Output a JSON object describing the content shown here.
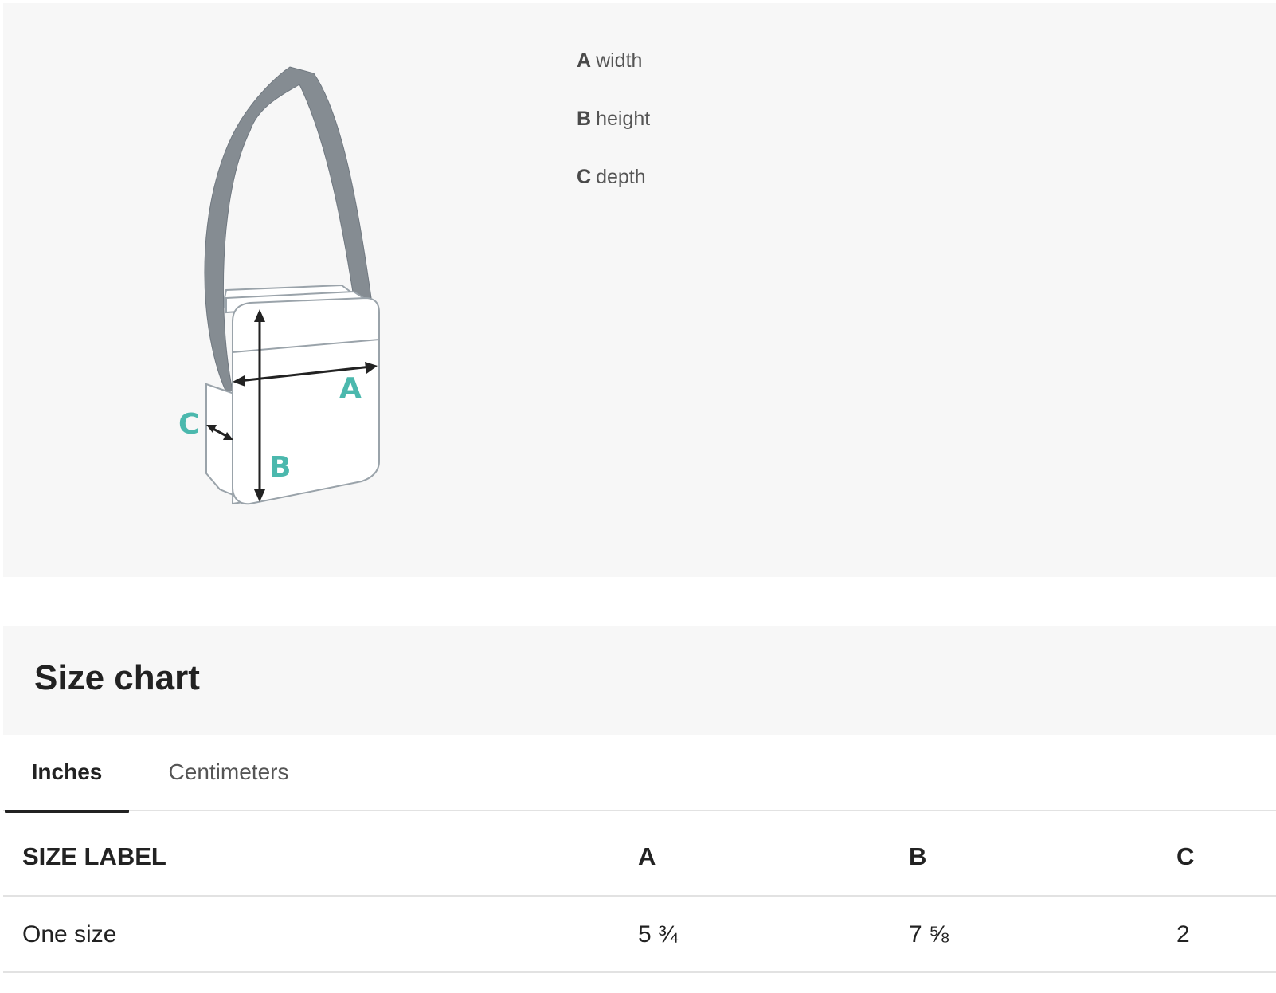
{
  "legend": [
    {
      "letter": "A",
      "text": "width"
    },
    {
      "letter": "B",
      "text": "height"
    },
    {
      "letter": "C",
      "text": "depth"
    }
  ],
  "diagram": {
    "label_a": "A",
    "label_b": "B",
    "label_c": "C"
  },
  "size_chart": {
    "title": "Size chart",
    "tabs": [
      {
        "label": "Inches",
        "active": true
      },
      {
        "label": "Centimeters",
        "active": false
      }
    ],
    "columns": [
      "SIZE LABEL",
      "A",
      "B",
      "C"
    ],
    "rows": [
      [
        "One size",
        "5 ¾",
        "7 ⅝",
        "2"
      ]
    ]
  },
  "colors": {
    "panel_bg": "#f7f7f7",
    "strap": "#858c92",
    "accent_letters": "#4bb8ad",
    "text": "#222222"
  }
}
